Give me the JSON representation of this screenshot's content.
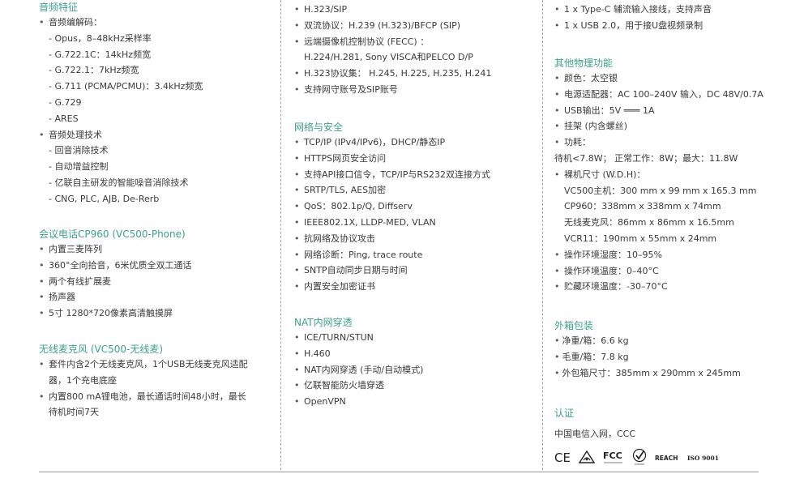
{
  "col1": {
    "audio": {
      "title": "音频特征",
      "codec_label": "音频编解码：",
      "codecs": [
        "Opus，8–48kHz采样率",
        "G.722.1C：14kHz频宽",
        "G.722.1：7kHz频宽",
        "G.711 (PCMA/PCMU)：3.4kHz频宽",
        "G.729",
        "ARES"
      ],
      "proc_label": "音频处理技术",
      "procs": [
        "回音消除技术",
        "自动增益控制",
        "亿联自主研发的智能噪音消除技术",
        "CNG, PLC, AJB, De-Rerb"
      ]
    },
    "phone": {
      "title": "会议电话CP960 (VC500-Phone)",
      "items": [
        "内置三麦阵列",
        "360°全向拾音，6米优质全双工通话",
        "两个有线扩展麦",
        "扬声器",
        "5寸 1280*720像素高清触摸屏"
      ]
    },
    "mic": {
      "title": "无线麦克风 (VC500-无线麦)",
      "items": [
        [
          "套件内含2个无线麦克风，1个USB无线麦克风适配",
          "器，1个充电底座"
        ],
        [
          "内置800 mA锂电池，最长通话时间48小时，最长",
          "待机时间7天"
        ]
      ]
    }
  },
  "col2": {
    "protocols": {
      "lines": [
        {
          "t": "b",
          "v": "H.323/SIP"
        },
        {
          "t": "b",
          "v": "双流协议：H.239 (H.323)/BFCP (SIP)"
        },
        {
          "t": "b",
          "v": "远端摄像机控制协议 (FECC) ："
        },
        {
          "t": "c",
          "v": "H.224/H.281, Sony VISCA和PELCO D/P"
        },
        {
          "t": "b",
          "v": "H.323协议集： H.245, H.225, H.235, H.241"
        },
        {
          "t": "b",
          "v": "支持网守账号及SIP账号"
        }
      ]
    },
    "network": {
      "title": "网络与安全",
      "items": [
        "TCP/IP (IPv4/IPv6)，DHCP/静态IP",
        "HTTPS网页安全访问",
        "支持API接口信令，TCP/IP与RS232双连接方式",
        "SRTP/TLS, AES加密",
        "QoS：802.1p/Q, Diffserv",
        "IEEE802.1X, LLDP-MED, VLAN",
        "抗网络及协议攻击",
        "网络诊断：Ping, trace route",
        "SNTP自动同步日期与时间",
        "内置安全加密证书"
      ]
    },
    "nat": {
      "title": "NAT内网穿透",
      "items": [
        "ICE/TURN/STUN",
        "H.460",
        "NAT内网穿透 (手动/自动模式)",
        "亿联智能防火墙穿透",
        "OpenVPN"
      ]
    }
  },
  "col3": {
    "interfaces": {
      "items": [
        "1 x Type-C 辅流输入接线，支持声音",
        "1 x USB 2.0，用于接U盘视频录制"
      ]
    },
    "physical": {
      "title": "其他物理功能",
      "lines": [
        {
          "t": "b",
          "v": "颜色：太空银"
        },
        {
          "t": "b",
          "v": "电源适配器：AC 100–240V 输入，DC 48V/0.7A"
        },
        {
          "t": "b",
          "v": "USB输出：5V ═══ 1A"
        },
        {
          "t": "b",
          "v": "挂架 (内含螺丝)"
        },
        {
          "t": "b",
          "v": "功耗："
        },
        {
          "t": "c2",
          "v": "待机<7.8W； 正常工作：8W；最大：11.8W"
        },
        {
          "t": "b",
          "v": "裸机尺寸 (W.D.H)："
        },
        {
          "t": "c",
          "v": "VC500主机：300 mm x 99 mm x 165.3 mm"
        },
        {
          "t": "c",
          "v": "CP960：338mm x 338mm x 74mm"
        },
        {
          "t": "c",
          "v": "无线麦克风：86mm x 86mm x 16.5mm"
        },
        {
          "t": "c",
          "v": "VCR11：190mm x 55mm x 24mm"
        },
        {
          "t": "b",
          "v": "操作环境湿度：10–95%"
        },
        {
          "t": "b",
          "v": "操作环境温度：0–40°C"
        },
        {
          "t": "b",
          "v": "贮藏环境温度：-30–70°C"
        }
      ]
    },
    "package": {
      "title": "外箱包装",
      "items": [
        "净重/箱：6.6 kg",
        "毛重/箱：7.8 kg",
        "外包箱尺寸：385mm x 290mm x 245mm"
      ]
    },
    "cert": {
      "title": "认证",
      "text": "中国电信入网，CCC",
      "logos": {
        "ce": "CE",
        "fcc": "FCC",
        "reach": "REACH",
        "iso": "ISO 9001"
      }
    }
  }
}
